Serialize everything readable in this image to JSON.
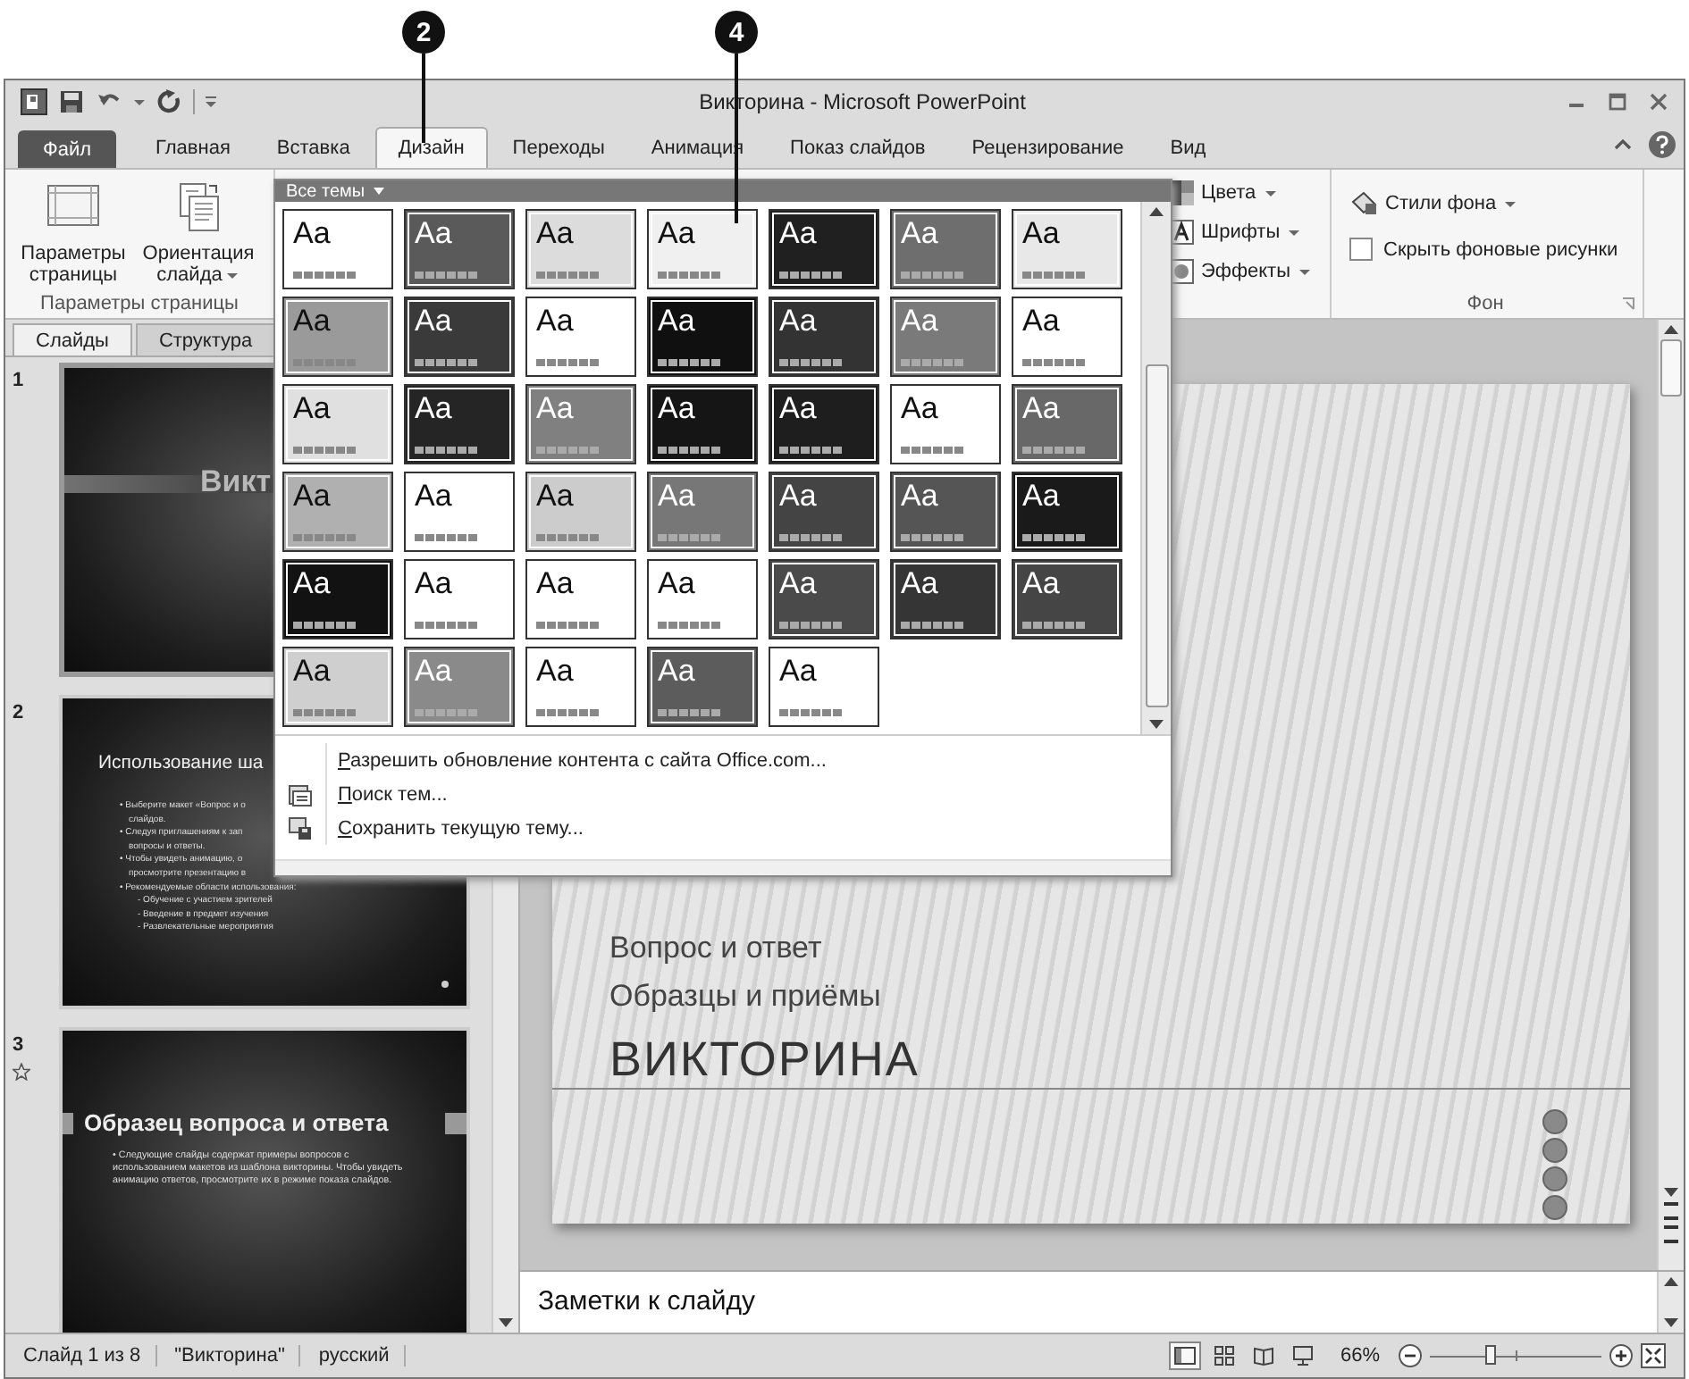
{
  "callouts": [
    {
      "label": "2"
    },
    {
      "label": "4"
    }
  ],
  "window": {
    "title": "Викторина - Microsoft PowerPoint"
  },
  "tabs": [
    {
      "label": "Файл",
      "kind": "file",
      "selected": false
    },
    {
      "label": "Главная",
      "kind": "tab",
      "selected": false
    },
    {
      "label": "Вставка",
      "kind": "tab",
      "selected": false
    },
    {
      "label": "Дизайн",
      "kind": "tab",
      "selected": true
    },
    {
      "label": "Переходы",
      "kind": "tab",
      "selected": false
    },
    {
      "label": "Анимация",
      "kind": "tab",
      "selected": false
    },
    {
      "label": "Показ слайдов",
      "kind": "tab",
      "selected": false
    },
    {
      "label": "Рецензирование",
      "kind": "tab",
      "selected": false
    },
    {
      "label": "Вид",
      "kind": "tab",
      "selected": false
    }
  ],
  "ribbon": {
    "page_setup": {
      "buttons": [
        {
          "label": "Параметры страницы",
          "kind": "page",
          "dropdown": false
        },
        {
          "label": "Ориентация слайда",
          "kind": "orientation",
          "dropdown": true
        }
      ],
      "group_label": "Параметры страницы"
    },
    "theme_options": [
      {
        "label": "Цвета",
        "kind": "colors"
      },
      {
        "label": "Шрифты",
        "kind": "fonts"
      },
      {
        "label": "Эффекты",
        "kind": "effects"
      }
    ],
    "background": {
      "styles_button": "Стили фона",
      "hide_graphics": {
        "label": "Скрыть фоновые рисунки",
        "checked": false
      },
      "group_label": "Фон"
    }
  },
  "themes_dropdown": {
    "header": "Все темы",
    "themes": [
      {
        "label": "Aa",
        "color": "#ffffff"
      },
      {
        "label": "Aa",
        "color": "#5a5a5a"
      },
      {
        "label": "Aa",
        "color": "#dcdcdc"
      },
      {
        "label": "Aa",
        "color": "#f0f0f0"
      },
      {
        "label": "Aa",
        "color": "#202020"
      },
      {
        "label": "Aa",
        "color": "#6e6e6e"
      },
      {
        "label": "Aa",
        "color": "#e8e8e8"
      },
      {
        "label": "Aa",
        "color": "#9a9a9a"
      },
      {
        "label": "Aa",
        "color": "#3a3a3a"
      },
      {
        "label": "Aa",
        "color": "#ffffff"
      },
      {
        "label": "Aa",
        "color": "#101010"
      },
      {
        "label": "Aa",
        "color": "#333333"
      },
      {
        "label": "Aa",
        "color": "#7a7a7a"
      },
      {
        "label": "Aa",
        "color": "#ffffff"
      },
      {
        "label": "Aa",
        "color": "#e0e0e0"
      },
      {
        "label": "Aa",
        "color": "#252525"
      },
      {
        "label": "Aa",
        "color": "#808080"
      },
      {
        "label": "Aa",
        "color": "#151515"
      },
      {
        "label": "Aa",
        "color": "#1e1e1e"
      },
      {
        "label": "Aa",
        "color": "#ffffff"
      },
      {
        "label": "Aa",
        "color": "#686868"
      },
      {
        "label": "Aa",
        "color": "#b0b0b0"
      },
      {
        "label": "Aa",
        "color": "#ffffff"
      },
      {
        "label": "Aa",
        "color": "#cccccc"
      },
      {
        "label": "Aa",
        "color": "#777777"
      },
      {
        "label": "Aa",
        "color": "#444444"
      },
      {
        "label": "Aa",
        "color": "#555555"
      },
      {
        "label": "Aa",
        "color": "#1a1a1a"
      },
      {
        "label": "Aa",
        "color": "#121212"
      },
      {
        "label": "Aa",
        "color": "#ffffff"
      },
      {
        "label": "Aa",
        "color": "#ffffff"
      },
      {
        "label": "Aa",
        "color": "#ffffff"
      },
      {
        "label": "Aa",
        "color": "#4a4a4a"
      },
      {
        "label": "Aa",
        "color": "#353535"
      },
      {
        "label": "Aa",
        "color": "#454545"
      },
      {
        "label": "Aa",
        "color": "#cfcfcf"
      },
      {
        "label": "Aa",
        "color": "#8a8a8a"
      },
      {
        "label": "Aa",
        "color": "#ffffff"
      },
      {
        "label": "Aa",
        "color": "#5c5c5c"
      },
      {
        "label": "Aa",
        "color": "#ffffff"
      }
    ],
    "menu": [
      {
        "label": "Разрешить обновление контента с сайта Office.com...",
        "kind": "plain"
      },
      {
        "label": "Поиск тем...",
        "kind": "browse"
      },
      {
        "label": "Сохранить текущую тему...",
        "kind": "save"
      }
    ]
  },
  "slide_panel": {
    "tabs": [
      {
        "label": "Слайды",
        "selected": true
      },
      {
        "label": "Структура",
        "selected": false
      }
    ],
    "slides": [
      {
        "number": "1",
        "kind": "title",
        "animated": false,
        "selected": true,
        "title": "Викт"
      },
      {
        "number": "2",
        "kind": "content",
        "animated": false,
        "selected": false,
        "title": "Использование ша",
        "lines": [
          {
            "text": "• Выберите макет «Вопрос и о",
            "kind": "bullet"
          },
          {
            "text": "слайдов.",
            "kind": "cont"
          },
          {
            "text": "• Следуя приглашениям к зап",
            "kind": "bullet"
          },
          {
            "text": "вопросы и ответы.",
            "kind": "cont"
          },
          {
            "text": "• Чтобы увидеть анимацию, о",
            "kind": "bullet"
          },
          {
            "text": "просмотрите презентацию в",
            "kind": "cont"
          },
          {
            "text": "• Рекомендуемые области использования:",
            "kind": "bullet"
          },
          {
            "text": "- Обучение с участием зрителей",
            "kind": "sub"
          },
          {
            "text": "- Введение в предмет изучения",
            "kind": "sub"
          },
          {
            "text": "- Развлекательные мероприятия",
            "kind": "sub"
          }
        ]
      },
      {
        "number": "3",
        "kind": "section",
        "animated": true,
        "selected": false,
        "title": "Образец вопроса и ответа",
        "lines": [
          {
            "text": "• Следующие слайды содержат примеры вопросов с использованием макетов из шаблона викторины. Чтобы увидеть анимацию ответов, просмотрите их в режиме показа слайдов.",
            "kind": "bullet"
          }
        ]
      }
    ]
  },
  "slide": {
    "lines": [
      {
        "text": "Вопрос и ответ",
        "kind": "subtitle"
      },
      {
        "text": "Образцы и приёмы",
        "kind": "subtitle"
      },
      {
        "text": "ВИКТОРИНА",
        "kind": "title"
      }
    ]
  },
  "notes": {
    "placeholder": "Заметки к слайду"
  },
  "status_bar": {
    "items": [
      "Слайд 1 из 8",
      "\"Викторина\"",
      "русский"
    ],
    "views": [
      {
        "kind": "normal",
        "selected": true
      },
      {
        "kind": "sorter",
        "selected": false
      },
      {
        "kind": "reading",
        "selected": false
      },
      {
        "kind": "show",
        "selected": false
      }
    ],
    "zoom": "66%",
    "zoom_slider": {
      "level": 0.35
    }
  }
}
